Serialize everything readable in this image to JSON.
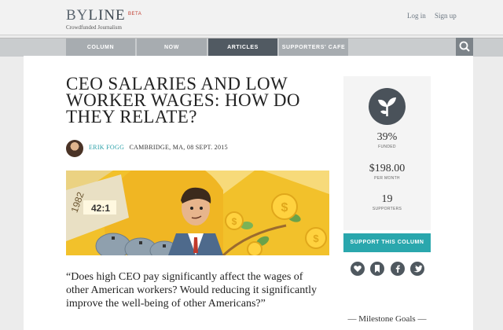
{
  "brand": {
    "name": "BYLINE",
    "name_part1": "BY",
    "name_part2": "LINE",
    "badge": "BETA",
    "tagline": "Crowdfunded Journalism"
  },
  "auth": {
    "login": "Log in",
    "signup": "Sign up"
  },
  "nav": {
    "items": [
      {
        "label": "COLUMN"
      },
      {
        "label": "NOW"
      },
      {
        "label": "ARTICLES",
        "active": true
      },
      {
        "label": "SUPPORTERS' CAFE"
      }
    ],
    "search_icon": "search-icon"
  },
  "article": {
    "title": "CEO SALARIES AND LOW WORKER WAGES: HOW DO THEY RELATE?",
    "author": "ERIK FOGG",
    "location": "CAMBRIDGE, MA,",
    "date": "08 SEPT. 2015",
    "image_text": {
      "year": "1982",
      "ratio": "42:1"
    },
    "quote": "“Does high CEO pay significantly affect the wages of other American workers? Would reducing it significantly improve the well-being of other Americans?”"
  },
  "sidebar": {
    "badge_icon": "sprout-icon",
    "stats": [
      {
        "value": "39%",
        "label": "FUNDED"
      },
      {
        "value": "$198.00",
        "label": "PER MONTH"
      },
      {
        "value": "19",
        "label": "SUPPORTERS"
      }
    ],
    "support_button": "SUPPORT THIS COLUMN",
    "social_icons": [
      "heart-icon",
      "bookmark-icon",
      "facebook-icon",
      "twitter-icon"
    ],
    "milestone_heading": "Milestone Goals",
    "milestone_display": "— Milestone Goals —"
  },
  "colors": {
    "accent": "#2aa7ad",
    "nav_active": "#515a62",
    "nav_bg": "#a7acb0",
    "beta": "#c0392b"
  }
}
